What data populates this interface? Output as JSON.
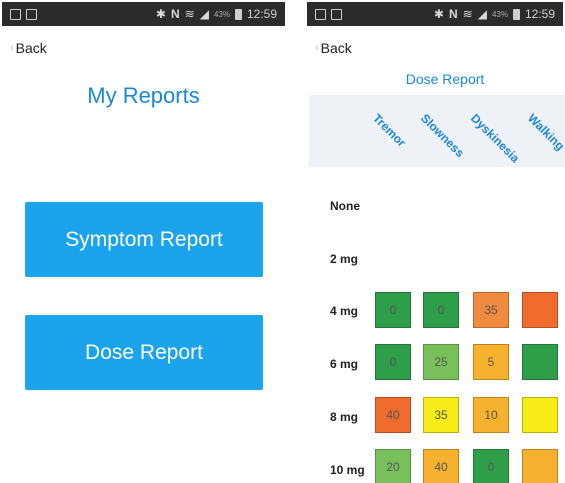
{
  "status_bar_left": {
    "time": "12:59",
    "battery": "43%"
  },
  "status_bar_right": {
    "time": "12:59",
    "battery": "43%"
  },
  "reports_screen": {
    "back_label": "Back",
    "title": "My Reports",
    "buttons": [
      "Symptom Report",
      "Dose Report"
    ]
  },
  "dose_screen": {
    "back_label": "Back",
    "title": "Dose Report",
    "columns": [
      "Tremor",
      "Slowness",
      "Dyskinesia",
      "Walking"
    ],
    "rows": [
      {
        "label": "None",
        "cells": []
      },
      {
        "label": "2 mg",
        "cells": []
      },
      {
        "label": "4 mg",
        "cells": [
          {
            "value": "0",
            "color": "#2e9e48"
          },
          {
            "value": "0",
            "color": "#2e9e48"
          },
          {
            "value": "35",
            "color": "#f08a3e"
          },
          {
            "value": "",
            "color": "#ef6b2e"
          }
        ]
      },
      {
        "label": "6 mg",
        "cells": [
          {
            "value": "0",
            "color": "#2e9e48"
          },
          {
            "value": "25",
            "color": "#77c05a"
          },
          {
            "value": "5",
            "color": "#f6b22e"
          },
          {
            "value": "",
            "color": "#2e9e48"
          }
        ]
      },
      {
        "label": "8 mg",
        "cells": [
          {
            "value": "40",
            "color": "#ef6b2e"
          },
          {
            "value": "35",
            "color": "#f7ec18"
          },
          {
            "value": "10",
            "color": "#f6b22e"
          },
          {
            "value": "",
            "color": "#f7ec18"
          }
        ]
      },
      {
        "label": "10 mg",
        "cells": [
          {
            "value": "20",
            "color": "#77c05a"
          },
          {
            "value": "40",
            "color": "#f6b22e"
          },
          {
            "value": "0",
            "color": "#2e9e48"
          },
          {
            "value": "",
            "color": "#f6b22e"
          }
        ]
      }
    ]
  },
  "icons": [
    "notification-icon",
    "screenshot-icon",
    "bluetooth-icon",
    "nfc-icon",
    "wifi-icon",
    "signal-icon",
    "battery-icon"
  ]
}
